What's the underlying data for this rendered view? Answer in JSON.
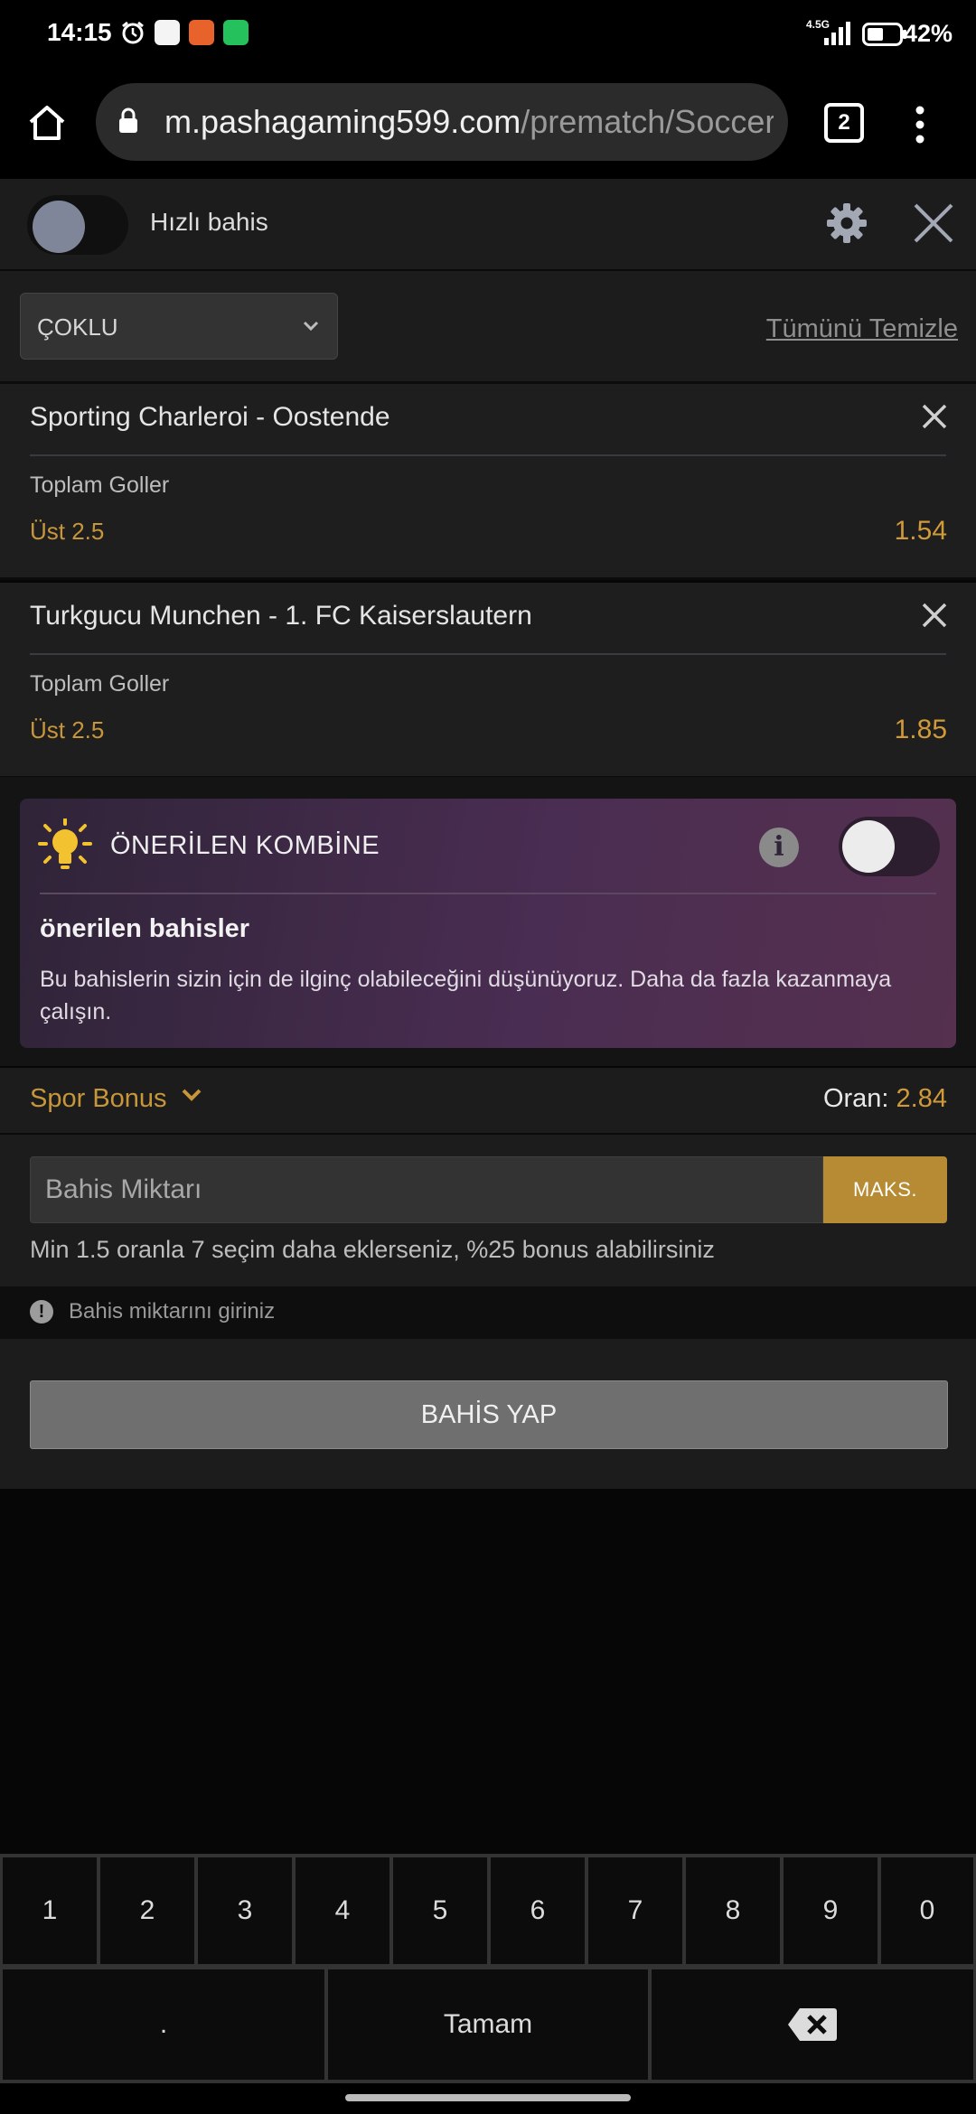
{
  "status_bar": {
    "time": "14:15",
    "network": "4.5G",
    "battery": "42%"
  },
  "browser": {
    "url_host": "m.pashagaming599.com",
    "url_path": "/prematch/Soccer",
    "tab_count": "2"
  },
  "quick_bet": {
    "label": "Hızlı bahis"
  },
  "bet_type": {
    "selected": "ÇOKLU",
    "clear_all": "Tümünü Temizle"
  },
  "bets": [
    {
      "match": "Sporting Charleroi - Oostende",
      "market": "Toplam Goller",
      "selection": "Üst 2.5",
      "odd": "1.54"
    },
    {
      "match": "Turkgucu Munchen - 1. FC Kaiserslautern",
      "market": "Toplam Goller",
      "selection": "Üst 2.5",
      "odd": "1.85"
    }
  ],
  "recommended": {
    "title": "ÖNERİLEN KOMBİNE",
    "subtitle": "önerilen bahisler",
    "description": "Bu bahislerin sizin için de ilginç olabileceğini düşünüyoruz. Daha da fazla kazanmaya çalışın."
  },
  "bonus": {
    "label": "Spor Bonus",
    "odds_label": "Oran:",
    "odds_value": "2.84"
  },
  "stake": {
    "placeholder": "Bahis Miktarı",
    "max_label": "MAKS.",
    "hint": "Min 1.5 oranla 7 seçim daha eklerseniz, %25 bonus alabilirsiniz"
  },
  "warning": {
    "text": "Bahis miktarını giriniz"
  },
  "place_bet": {
    "label": "BAHİS YAP"
  },
  "keyboard": {
    "digits": [
      "1",
      "2",
      "3",
      "4",
      "5",
      "6",
      "7",
      "8",
      "9",
      "0"
    ],
    "dot": ".",
    "done": "Tamam"
  },
  "colors": {
    "accent": "#c8963a",
    "max_button": "#b68b34",
    "panel": "#1c1c1c"
  }
}
